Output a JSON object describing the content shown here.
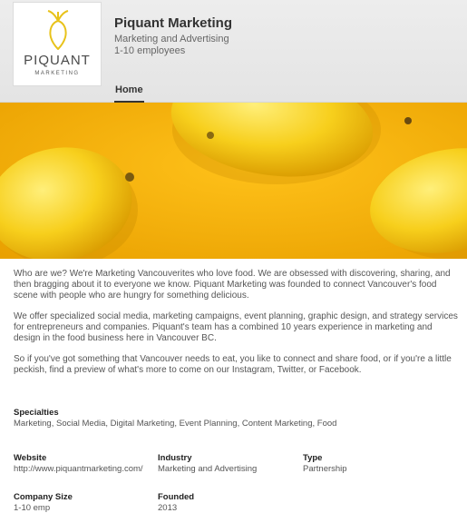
{
  "header": {
    "logo_word": "PIQUANT",
    "logo_sub": "MARKETING",
    "company_name": "Piquant Marketing",
    "industry": "Marketing and Advertising",
    "size": "1-10 employees",
    "tabs": [
      {
        "label": "Home"
      }
    ]
  },
  "colors": {
    "accent": "#f2b400",
    "logo_lemon": "#e8c21a"
  },
  "about": {
    "paragraphs": [
      "Who are we? We're Marketing Vancouverites who love food. We are obsessed with discovering, sharing, and then bragging about it to everyone we know. Piquant Marketing was founded to connect Vancouver's food scene with people who are hungry for something delicious.",
      "We offer specialized social media, marketing campaigns, event planning, graphic design, and strategy services for entrepreneurs and companies. Piquant's team has a combined 10 years experience in marketing and design in the food business here in Vancouver BC.",
      "So if you've got something that Vancouver needs to eat, you like to connect and share food, or if you're a little peckish, find a preview of what's more to come on our Instagram, Twitter, or Facebook."
    ]
  },
  "details": {
    "specialties_label": "Specialties",
    "specialties_value": "Marketing, Social Media, Digital Marketing, Event Planning, Content Marketing, Food",
    "website_label": "Website",
    "website_value": "http://www.piquantmarketing.com/",
    "industry_label": "Industry",
    "industry_value": "Marketing and Advertising",
    "type_label": "Type",
    "type_value": "Partnership",
    "company_size_label": "Company Size",
    "company_size_value": "1-10 emp",
    "founded_label": "Founded",
    "founded_value": "2013"
  }
}
